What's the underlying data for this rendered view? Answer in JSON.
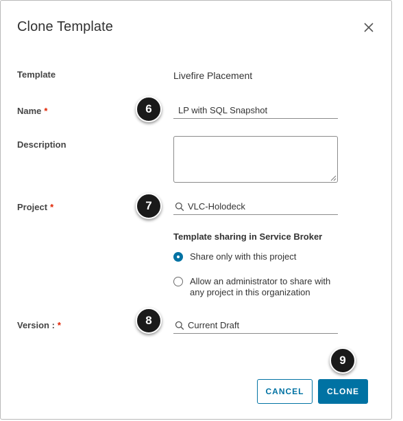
{
  "dialog": {
    "title": "Clone Template",
    "close_icon": "close-icon"
  },
  "fields": {
    "template_label": "Template",
    "template_value": "Livefire Placement",
    "name_label": "Name",
    "name_value": "LP with SQL Snapshot",
    "description_label": "Description",
    "description_value": "",
    "project_label": "Project",
    "project_value": "VLC-Holodeck",
    "version_label": "Version :",
    "version_value": "Current Draft",
    "required_marker": "*"
  },
  "sharing": {
    "heading": "Template sharing in Service Broker",
    "option_1": "Share only with this project",
    "option_2_line1": "Allow an administrator to share with",
    "option_2_line2": "any project in this organization",
    "selected": "option_1"
  },
  "buttons": {
    "cancel": "CANCEL",
    "clone": "CLONE"
  },
  "badges": {
    "step_name": "6",
    "step_project": "7",
    "step_version": "8",
    "step_clone": "9"
  },
  "colors": {
    "primary": "#0072a3",
    "required": "#e02200",
    "badge": "#1a1a1a"
  }
}
